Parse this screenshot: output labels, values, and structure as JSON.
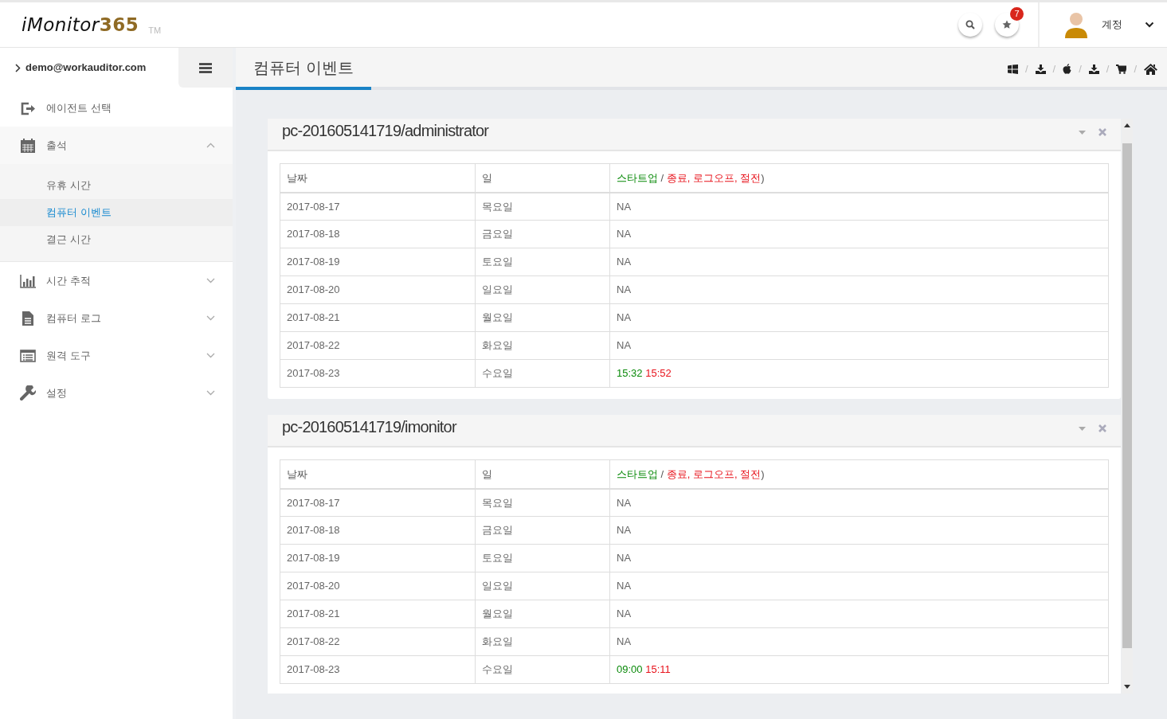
{
  "brand": {
    "name": "iMonitor",
    "number": "365",
    "mark": "TM"
  },
  "header": {
    "notifications": "7",
    "account": "계정"
  },
  "sidebar": {
    "user": "demo@workauditor.com",
    "items": [
      {
        "label": "에이전트 선택"
      },
      {
        "label": "출석",
        "expanded": true,
        "children": [
          {
            "label": "유휴 시간",
            "selected": false
          },
          {
            "label": "컴퓨터 이벤트",
            "selected": true
          },
          {
            "label": "결근 시간",
            "selected": false
          }
        ]
      },
      {
        "label": "시간 추적",
        "expanded": false
      },
      {
        "label": "컴퓨터 로그",
        "expanded": false
      },
      {
        "label": "원격 도구",
        "expanded": false
      },
      {
        "label": "설정",
        "expanded": false
      }
    ]
  },
  "page": {
    "title": "컴퓨터 이벤트",
    "separators": [
      "/",
      "/",
      "/",
      "/",
      "/"
    ]
  },
  "panels": [
    {
      "title": "pc-201605141719/administrator",
      "columns": [
        {
          "parts": [
            {
              "text": "날짜",
              "kind": "plain"
            }
          ]
        },
        {
          "parts": [
            {
              "text": "일",
              "kind": "plain"
            }
          ]
        },
        {
          "parts": [
            {
              "text": "스타트업",
              "kind": "startup"
            },
            {
              "text": " / ",
              "kind": "plain"
            },
            {
              "text": "종료, 로그오프, 절전",
              "kind": "shutdown"
            },
            {
              "text": ")",
              "kind": "plain"
            }
          ]
        }
      ],
      "rows": [
        {
          "date": "2017-08-17",
          "day": "목요일",
          "events": [
            {
              "text": "NA",
              "kind": "none"
            }
          ]
        },
        {
          "date": "2017-08-18",
          "day": "금요일",
          "events": [
            {
              "text": "NA",
              "kind": "none"
            }
          ]
        },
        {
          "date": "2017-08-19",
          "day": "토요일",
          "events": [
            {
              "text": "NA",
              "kind": "none"
            }
          ]
        },
        {
          "date": "2017-08-20",
          "day": "일요일",
          "events": [
            {
              "text": "NA",
              "kind": "none"
            }
          ]
        },
        {
          "date": "2017-08-21",
          "day": "월요일",
          "events": [
            {
              "text": "NA",
              "kind": "none"
            }
          ]
        },
        {
          "date": "2017-08-22",
          "day": "화요일",
          "events": [
            {
              "text": "NA",
              "kind": "none"
            }
          ]
        },
        {
          "date": "2017-08-23",
          "day": "수요일",
          "events": [
            {
              "text": "15:32",
              "kind": "startup"
            },
            {
              "text": "15:52",
              "kind": "shutdown"
            }
          ]
        }
      ]
    },
    {
      "title": "pc-201605141719/imonitor",
      "columns": [
        {
          "parts": [
            {
              "text": "날짜",
              "kind": "plain"
            }
          ]
        },
        {
          "parts": [
            {
              "text": "일",
              "kind": "plain"
            }
          ]
        },
        {
          "parts": [
            {
              "text": "스타트업",
              "kind": "startup"
            },
            {
              "text": " / ",
              "kind": "plain"
            },
            {
              "text": "종료, 로그오프, 절전",
              "kind": "shutdown"
            },
            {
              "text": ")",
              "kind": "plain"
            }
          ]
        }
      ],
      "rows": [
        {
          "date": "2017-08-17",
          "day": "목요일",
          "events": [
            {
              "text": "NA",
              "kind": "none"
            }
          ]
        },
        {
          "date": "2017-08-18",
          "day": "금요일",
          "events": [
            {
              "text": "NA",
              "kind": "none"
            }
          ]
        },
        {
          "date": "2017-08-19",
          "day": "토요일",
          "events": [
            {
              "text": "NA",
              "kind": "none"
            }
          ]
        },
        {
          "date": "2017-08-20",
          "day": "일요일",
          "events": [
            {
              "text": "NA",
              "kind": "none"
            }
          ]
        },
        {
          "date": "2017-08-21",
          "day": "월요일",
          "events": [
            {
              "text": "NA",
              "kind": "none"
            }
          ]
        },
        {
          "date": "2017-08-22",
          "day": "화요일",
          "events": [
            {
              "text": "NA",
              "kind": "none"
            }
          ]
        },
        {
          "date": "2017-08-23",
          "day": "수요일",
          "events": [
            {
              "text": "09:00",
              "kind": "startup"
            },
            {
              "text": "15:11",
              "kind": "shutdown"
            }
          ]
        }
      ]
    }
  ]
}
